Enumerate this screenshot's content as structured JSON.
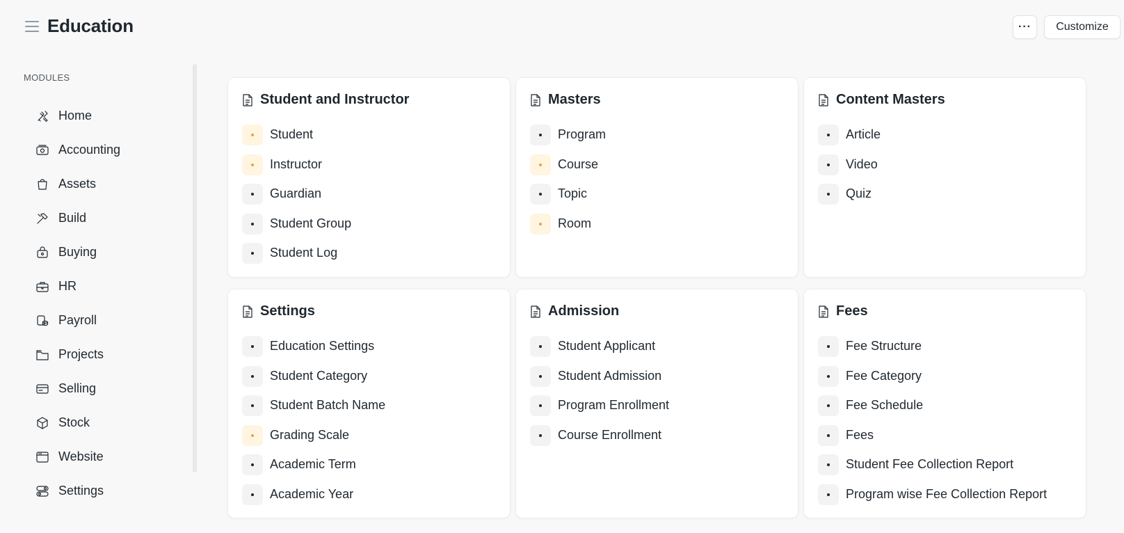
{
  "header": {
    "title": "Education",
    "more_label": "···",
    "customize_label": "Customize"
  },
  "sidebar": {
    "heading": "MODULES",
    "items": [
      {
        "label": "Home",
        "icon": "tools-icon"
      },
      {
        "label": "Accounting",
        "icon": "money-icon"
      },
      {
        "label": "Assets",
        "icon": "bag-icon"
      },
      {
        "label": "Build",
        "icon": "hammer-icon"
      },
      {
        "label": "Buying",
        "icon": "shopping-bag-icon"
      },
      {
        "label": "HR",
        "icon": "briefcase-icon"
      },
      {
        "label": "Payroll",
        "icon": "coins-icon"
      },
      {
        "label": "Projects",
        "icon": "folder-icon"
      },
      {
        "label": "Selling",
        "icon": "card-icon"
      },
      {
        "label": "Stock",
        "icon": "box-icon"
      },
      {
        "label": "Website",
        "icon": "browser-icon"
      },
      {
        "label": "Settings",
        "icon": "toggle-icon"
      }
    ]
  },
  "cards": [
    {
      "title": "Student and Instructor",
      "links": [
        {
          "label": "Student",
          "highlight": true
        },
        {
          "label": "Instructor",
          "highlight": true
        },
        {
          "label": "Guardian",
          "highlight": false
        },
        {
          "label": "Student Group",
          "highlight": false
        },
        {
          "label": "Student Log",
          "highlight": false
        }
      ]
    },
    {
      "title": "Masters",
      "links": [
        {
          "label": "Program",
          "highlight": false
        },
        {
          "label": "Course",
          "highlight": true
        },
        {
          "label": "Topic",
          "highlight": false
        },
        {
          "label": "Room",
          "highlight": true
        }
      ]
    },
    {
      "title": "Content Masters",
      "links": [
        {
          "label": "Article",
          "highlight": false
        },
        {
          "label": "Video",
          "highlight": false
        },
        {
          "label": "Quiz",
          "highlight": false
        }
      ]
    },
    {
      "title": "Settings",
      "links": [
        {
          "label": "Education Settings",
          "highlight": false
        },
        {
          "label": "Student Category",
          "highlight": false
        },
        {
          "label": "Student Batch Name",
          "highlight": false
        },
        {
          "label": "Grading Scale",
          "highlight": true
        },
        {
          "label": "Academic Term",
          "highlight": false
        },
        {
          "label": "Academic Year",
          "highlight": false
        }
      ]
    },
    {
      "title": "Admission",
      "links": [
        {
          "label": "Student Applicant",
          "highlight": false
        },
        {
          "label": "Student Admission",
          "highlight": false
        },
        {
          "label": "Program Enrollment",
          "highlight": false
        },
        {
          "label": "Course Enrollment",
          "highlight": false
        }
      ]
    },
    {
      "title": "Fees",
      "links": [
        {
          "label": "Fee Structure",
          "highlight": false
        },
        {
          "label": "Fee Category",
          "highlight": false
        },
        {
          "label": "Fee Schedule",
          "highlight": false
        },
        {
          "label": "Fees",
          "highlight": false
        },
        {
          "label": "Student Fee Collection Report",
          "highlight": false
        },
        {
          "label": "Program wise Fee Collection Report",
          "highlight": false
        }
      ]
    }
  ],
  "colors": {
    "accent": "#e8a33b",
    "accent_bg": "#fff5e0",
    "text": "#1f272e"
  }
}
